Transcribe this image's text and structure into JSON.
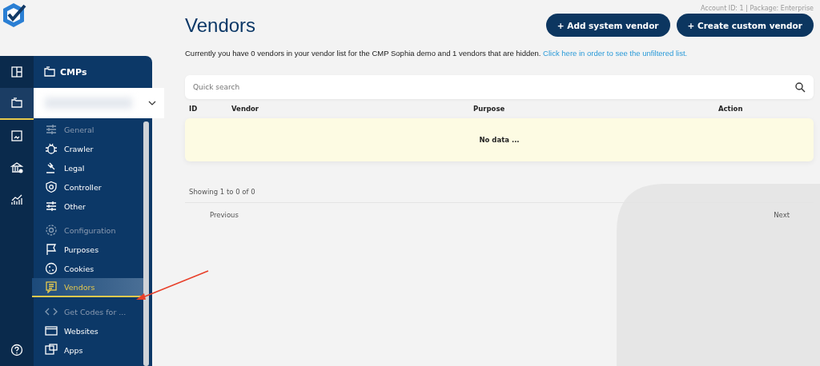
{
  "account_info": "Account ID: 1 | Package: Enterprise",
  "rail": [
    {
      "selected": false
    },
    {
      "selected": true
    },
    {
      "selected": false
    },
    {
      "selected": false
    },
    {
      "selected": false
    }
  ],
  "sidebar": {
    "title": "CMPs",
    "items": [
      {
        "kind": "heading",
        "label": "General",
        "selected": false
      },
      {
        "kind": "link",
        "label": "Crawler",
        "selected": false
      },
      {
        "kind": "link",
        "label": "Legal",
        "selected": false
      },
      {
        "kind": "link",
        "label": "Controller",
        "selected": false
      },
      {
        "kind": "link",
        "label": "Other",
        "selected": false
      },
      {
        "kind": "heading",
        "label": "Configuration",
        "selected": false
      },
      {
        "kind": "link",
        "label": "Purposes",
        "selected": false
      },
      {
        "kind": "link",
        "label": "Cookies",
        "selected": false
      },
      {
        "kind": "link",
        "label": "Vendors",
        "selected": true
      },
      {
        "kind": "heading",
        "label": "Get Codes for ...",
        "selected": false
      },
      {
        "kind": "link",
        "label": "Websites",
        "selected": false
      },
      {
        "kind": "link",
        "label": "Apps",
        "selected": false
      }
    ]
  },
  "page": {
    "title": "Vendors",
    "buttons": [
      "+ Add system vendor",
      "+ Create custom vendor"
    ],
    "notice": "Currently you have 0 vendors in your vendor list for the CMP Sophia demo and 1 vendors that are hidden.",
    "notice_link": "Click here in order to see the unfiltered list."
  },
  "search": {
    "placeholder": "Quick search"
  },
  "table": {
    "columns": [
      "ID",
      "Vendor",
      "Purpose",
      "Action"
    ],
    "empty_text": "No data ..."
  },
  "pagination": {
    "info": "Showing 1 to 0 of 0",
    "previous": "Previous",
    "next": "Next"
  }
}
